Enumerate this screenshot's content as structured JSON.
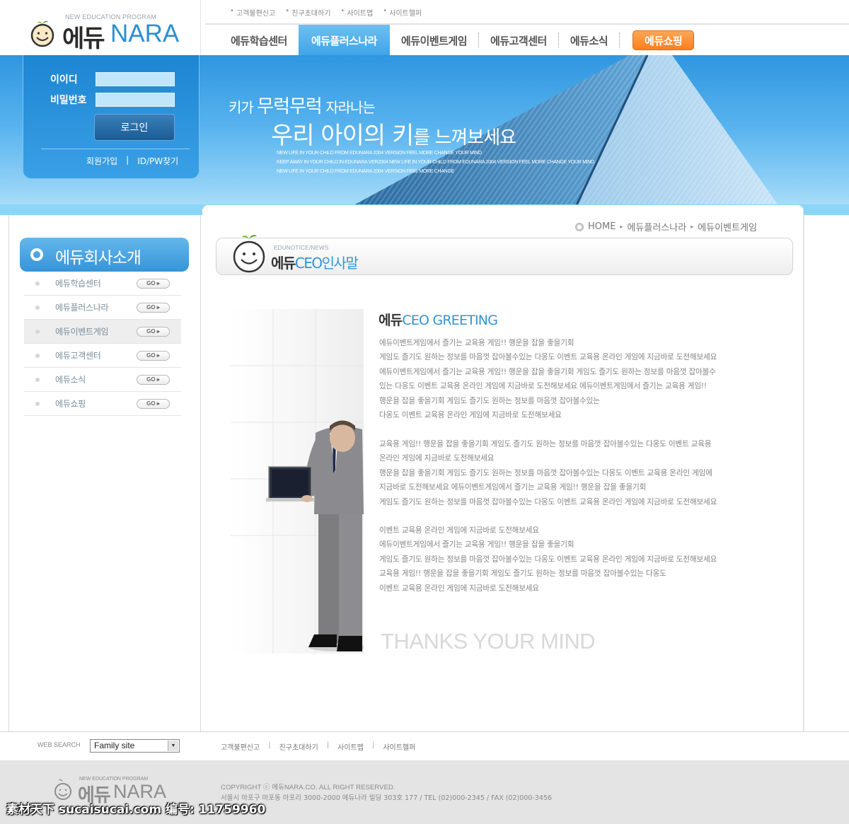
{
  "logo": {
    "program": "NEW EDUCATION PROGRAM",
    "edu": "에듀",
    "nara": "NARA"
  },
  "utility_links": [
    "고객불편신고",
    "친구초대하기",
    "사이트맵",
    "사이트헬퍼"
  ],
  "nav": {
    "items": [
      "에듀학습센터",
      "에듀플러스나라",
      "에듀이벤트게임",
      "에듀고객센터",
      "에듀소식"
    ],
    "active_index": 1,
    "shop": "에듀쇼핑"
  },
  "login": {
    "id_label": "이이디",
    "pw_label": "비밀번호",
    "button": "로그인",
    "join": "회원가입",
    "separator": "|",
    "find": "ID/PW찾기"
  },
  "banner": {
    "line1_a": "키가 ",
    "line1_b": "무럭무럭",
    "line1_c": " 자라나는",
    "line2_a": "우리 아이의 키",
    "line2_b": "를 느껴보세요",
    "eng1": "NEW LIFE IN YOUR CHILD FROM EDUNARA 2004 VERSION FEEL MORE CHANGE YOUR MIND",
    "eng2": "KEEP AWAY IN YOUR CHILD IN EDUNARA VER2004 NEW LIFE IN YOUR CHILD FROM EDUNARA 2004 VERSION FEEL MORE CHANGE YOUR MIND",
    "eng3": "NEW LIFE IN YOUR CHILD FROM EDUNARA 2004 VERSION FEEL MORE CHANGE"
  },
  "sidebar": {
    "title": "에듀회사소개",
    "go_label": "GO ▸",
    "active_index": 2,
    "items": [
      "에듀학습센터",
      "에듀플러스나라",
      "에듀이벤트게임",
      "에듀고객센터",
      "에듀소식",
      "에듀쇼핑"
    ]
  },
  "breadcrumb": {
    "home": "HOME",
    "arrow": "▸",
    "level1": "에듀플러스나라",
    "level2": "에듀이벤트게임"
  },
  "page_title": {
    "sub": "EDUNOTICE/NEWS",
    "dark": "에듀",
    "blue": "CEO인사말"
  },
  "greeting": {
    "dark": "에듀",
    "blue": "CEO GREETING",
    "lines": [
      "에듀이벤트게임에서 즐기는 교육용 게임!! 행운을 잡을 좋을기회",
      "게임도 즐기도 원하는 정보를 마음껏 잡아볼수있는 다옹도 이벤트 교육용 온라인 게임에 지금바로 도전해보세요",
      "에듀이벤트게임에서 즐기는 교육용 게임!! 행운을 잡을 좋을기회 게임도 즐기도 원하는 정보를 마음껏 잡아볼수",
      "있는 다옹도 이벤트 교육용 온라인 게임에 지금바로 도전해보세요 에듀이벤트게임에서 즐기는 교육용 게임!!",
      "행운을 잡을 좋을기회 게임도 즐기도 원하는 정보를 마음껏 잡아볼수있는",
      "다옹도 이벤트 교육용 온라인 게임에 지금바로 도전해보세요",
      "교육용 게임!! 행운을 잡을 좋을기회 게임도 즐기도 원하는 정보를 마음껏 잡아볼수있는 다옹도 이벤트 교육용",
      "온라인 게임에 지금바로 도전해보세요",
      "행운을 잡을 좋을기회 게임도 즐기도 원하는 정보를 마음껏 잡아볼수있는 다옹도 이벤트 교육용 온라인 게임에",
      "지금바로 도전해보세요 에듀이벤트게임에서 즐기는 교육용 게임!! 행운을 잡을 좋을기회",
      "게임도 즐기도 원하는 정보를 마음껏 잡아볼수있는 다옹도 이벤트 교육용 온라인 게임에 지금바로 도전해보세요",
      "이벤트 교육용 온라인 게임에 지금바로 도전해보세요",
      "에듀이벤트게임에서 즐기는 교육용 게임!! 행운을 잡을 좋을기회",
      "게임도 즐기도 원하는 정보를 마음껏 잡아볼수있는 다옹도 이벤트 교육용 온라인 게임에 지금바로 도전해보세요",
      "교육용 게임!! 행운을 잡을 좋을기회 게임도 즐기도 원하는 정보를 마음껏 잡아볼수있는 다옹도",
      "이벤트 교육용 온라인 게임에 지금바로 도전해보세요"
    ],
    "thanks": "THANKS YOUR MIND"
  },
  "footer": {
    "web_search": "WEB SEARCH",
    "family_site": "Family site",
    "links": [
      "고객불편신고",
      "친구초대하기",
      "사이트맵",
      "사이트헬퍼"
    ],
    "link_sep": "|",
    "logo_program": "NEW EDUCATION PROGRAM",
    "logo_edu": "에듀",
    "logo_nara": "NARA",
    "copyright": "COPYRIGHT ⓒ 에듀NARA.CO. ALL RIGHT RESERVED.",
    "address": "서울시 마포구 마포동 마포리 3000-2000 에듀나라 빌딩 303호 177 / TEL (02)000-2345 / FAX (02)000-3456"
  },
  "watermark": "素材天下 sucaisucai.com  编号: 11759960",
  "colors": {
    "accent_blue": "#2f95d8",
    "shop_orange": "#ff7f1e",
    "banner_blue": "#3a9fe6"
  }
}
